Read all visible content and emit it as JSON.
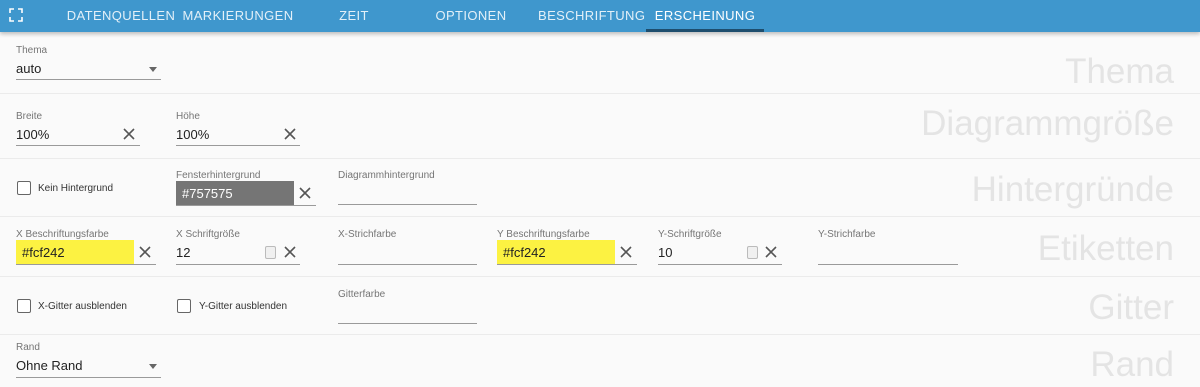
{
  "tabs": [
    "DATENQUELLEN",
    "MARKIERUNGEN",
    "ZEIT",
    "OPTIONEN",
    "BESCHRIFTUNG",
    "ERSCHEINUNG"
  ],
  "sections": {
    "thema": "Thema",
    "size": "Diagrammgröße",
    "backgrounds": "Hintergründe",
    "labels": "Etiketten",
    "grid": "Gitter",
    "border": "Rand"
  },
  "theme": {
    "label": "Thema",
    "value": "auto"
  },
  "width": {
    "label": "Breite",
    "value": "100%"
  },
  "height": {
    "label": "Höhe",
    "value": "100%"
  },
  "no_background": {
    "label": "Kein Hintergrund",
    "checked": false
  },
  "window_bg": {
    "label": "Fensterhintergrund",
    "value": "#757575"
  },
  "chart_bg": {
    "label": "Diagrammhintergrund",
    "value": ""
  },
  "x_label_color": {
    "label": "X Beschriftungsfarbe",
    "value": "#fcf242"
  },
  "x_font_size": {
    "label": "X Schriftgröße",
    "value": "12"
  },
  "x_stroke_color": {
    "label": "X-Strichfarbe",
    "value": ""
  },
  "y_label_color": {
    "label": "Y Beschriftungsfarbe",
    "value": "#fcf242"
  },
  "y_font_size": {
    "label": "Y-Schriftgröße",
    "value": "10"
  },
  "y_stroke_color": {
    "label": "Y-Strichfarbe",
    "value": ""
  },
  "hide_x_grid": {
    "label": "X-Gitter ausblenden",
    "checked": false
  },
  "hide_y_grid": {
    "label": "Y-Gitter ausblenden",
    "checked": false
  },
  "grid_color": {
    "label": "Gitterfarbe",
    "value": ""
  },
  "border": {
    "label": "Rand",
    "value": "Ohne Rand"
  },
  "colors": {
    "accent": "#3f97cd",
    "highlight": "#fcf242",
    "window_bg": "#757575"
  }
}
